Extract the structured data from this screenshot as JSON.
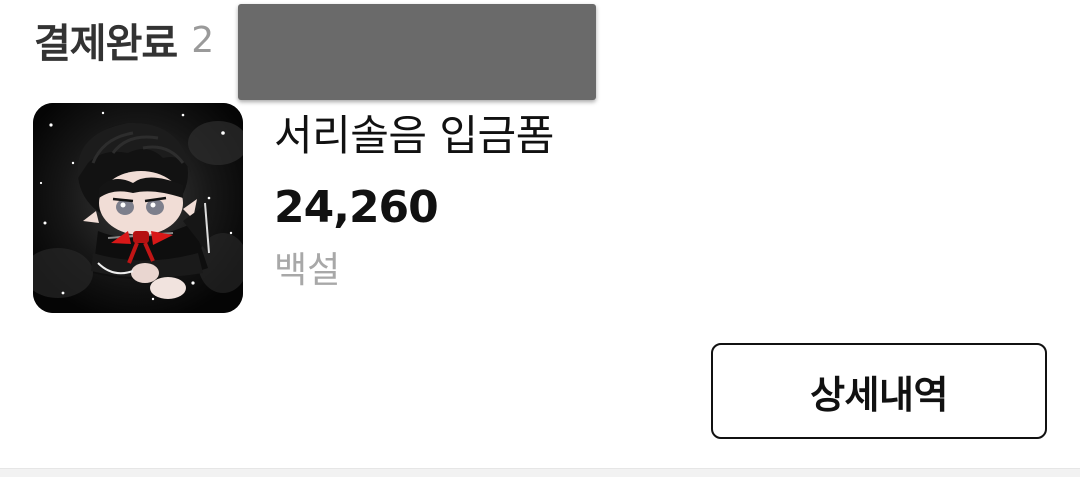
{
  "order": {
    "status": "결제완료",
    "date_prefix": "2"
  },
  "product": {
    "name": "서리솔음 입금폼",
    "price": "24,260",
    "option": "백설",
    "image_icon": "plush-doll-photo"
  },
  "actions": {
    "detail_label": "상세내역"
  },
  "colors": {
    "title": "#333333",
    "muted": "#a8a8a8",
    "redaction": "#6a6a6a",
    "button_border": "#111111"
  }
}
